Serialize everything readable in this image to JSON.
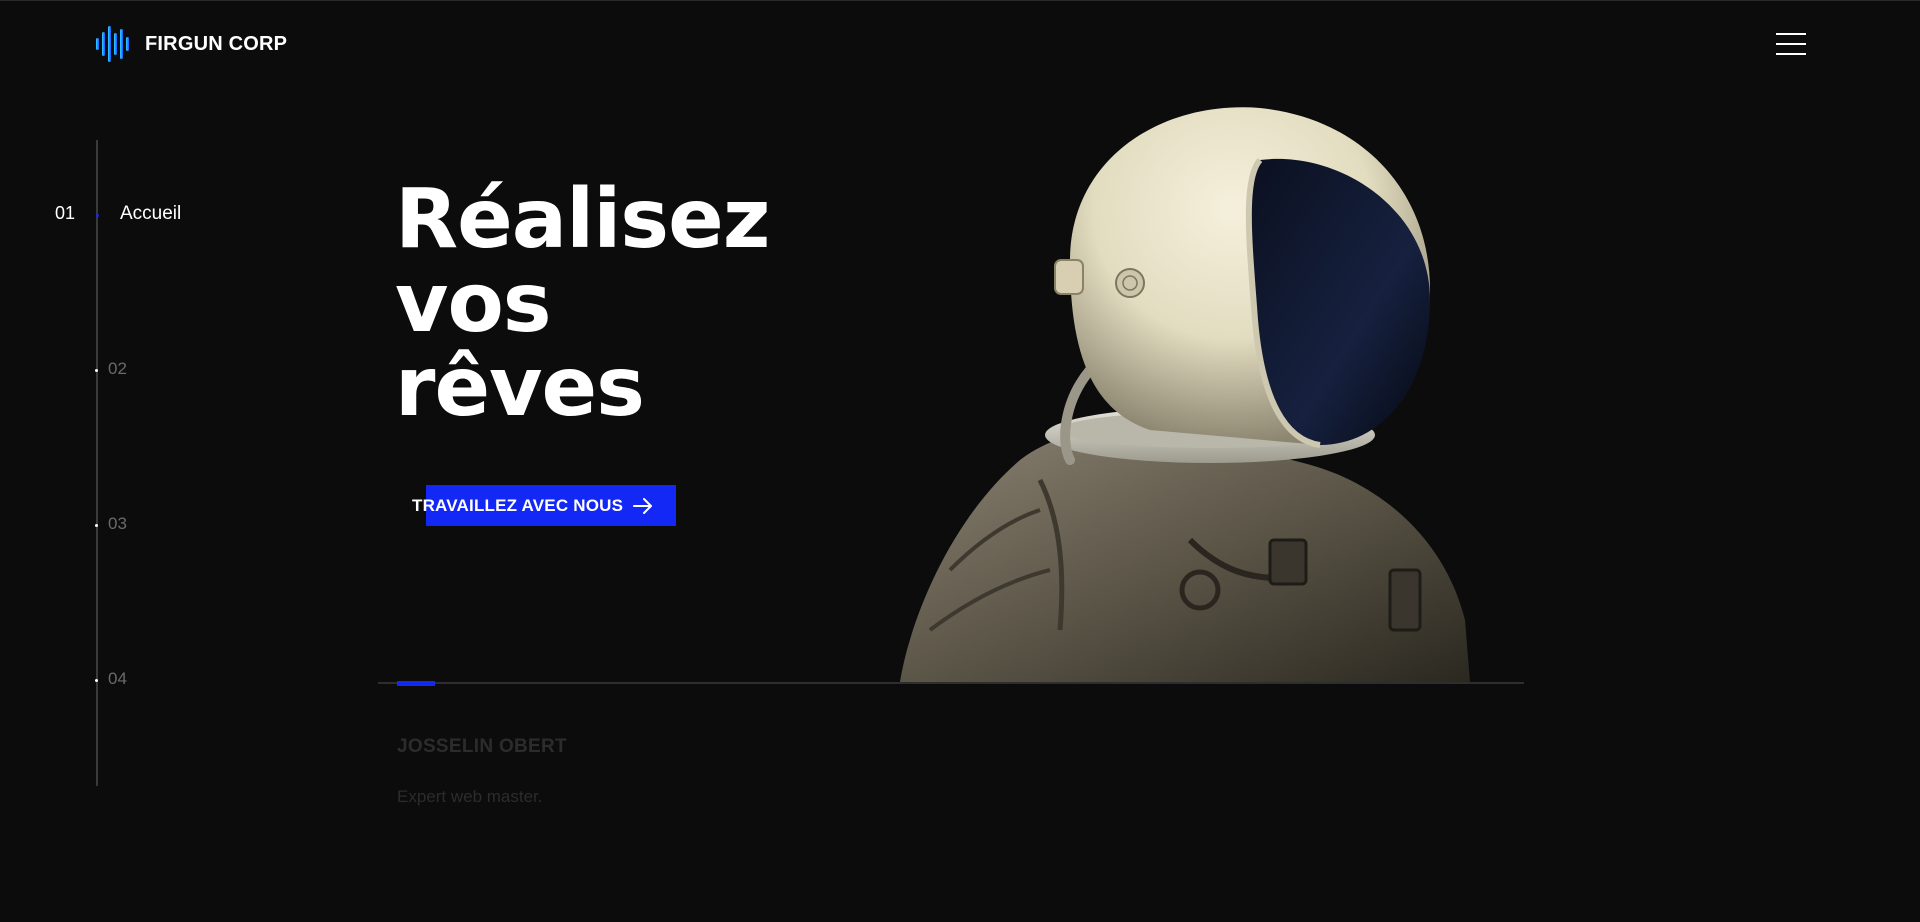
{
  "brand": {
    "name": "FIRGUN CORP",
    "accent": "#1428f5",
    "logo_gradient": [
      "#2fd0ff",
      "#1a55ff"
    ]
  },
  "header": {
    "menu_icon": "hamburger-icon"
  },
  "nav": {
    "items": [
      {
        "number": "01",
        "label": "Accueil",
        "active": true
      },
      {
        "number": "02",
        "label": "",
        "active": false
      },
      {
        "number": "03",
        "label": "",
        "active": false
      },
      {
        "number": "04",
        "label": "",
        "active": false
      }
    ]
  },
  "hero": {
    "title_lines": [
      "Réalisez",
      "vos",
      "rêves"
    ],
    "cta_label": "TRAVAILLEZ AVEC NOUS",
    "cta_icon": "arrow-right-icon"
  },
  "slide": {
    "progress": 0.04,
    "author": "JOSSELIN OBERT",
    "role": "Expert web master."
  },
  "colors": {
    "background": "#0c0c0c",
    "text": "#ffffff",
    "muted": "#6a6a6a"
  }
}
